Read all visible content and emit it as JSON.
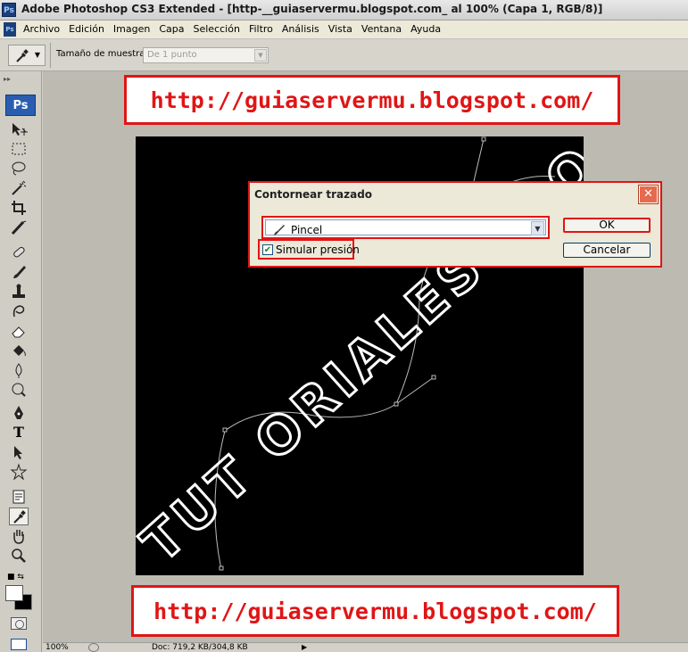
{
  "window": {
    "title": "Adobe Photoshop CS3 Extended - [http-__guiaservermu.blogspot.com_ al 100% (Capa 1, RGB/8)]",
    "app_icon": "Ps"
  },
  "menu": {
    "items": [
      "Archivo",
      "Edición",
      "Imagen",
      "Capa",
      "Selección",
      "Filtro",
      "Análisis",
      "Vista",
      "Ventana",
      "Ayuda"
    ]
  },
  "options": {
    "sample_size_label": "Tamaño de muestra:",
    "sample_size_value": "De 1 punto"
  },
  "toolbox": {
    "badge": "Ps",
    "type_tool": "T"
  },
  "banners": {
    "top_url": "http://guiaservermu.blogspot.com/",
    "bottom_url": "http://guiaservermu.blogspot.com/"
  },
  "canvas": {
    "art_text": "TUT ORIALES BLOG"
  },
  "dialog": {
    "title": "Contornear trazado",
    "close_label": "✕",
    "tool_value": "Pincel",
    "simulate_pressure_label": "Simular presión",
    "simulate_pressure_checked": true,
    "ok_label": "OK",
    "cancel_label": "Cancelar"
  },
  "status": {
    "zoom": "100%",
    "doc_info": "Doc: 719,2 KB/304,8 KB"
  },
  "colors": {
    "highlight_red": "#e01515",
    "canvas_bg": "#000000",
    "workspace_bg": "#bdbab1"
  }
}
